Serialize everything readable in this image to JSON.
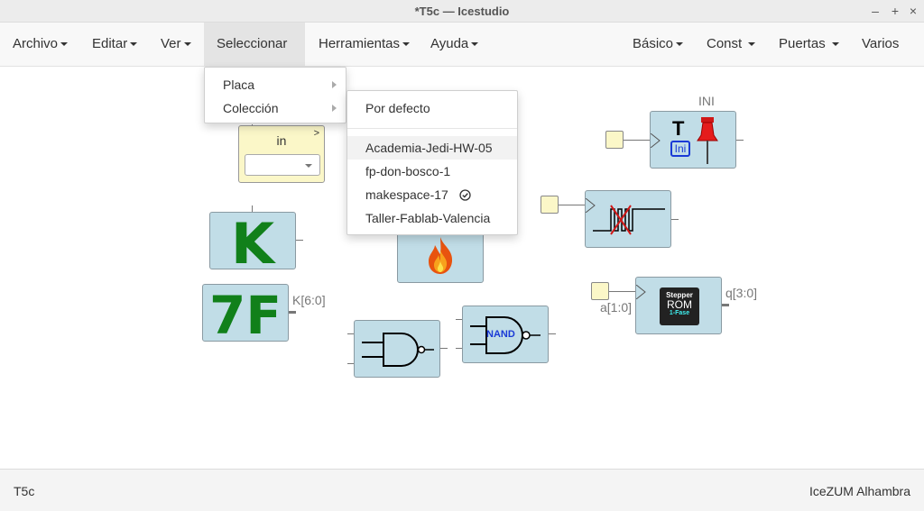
{
  "window": {
    "title": "*T5c — Icestudio"
  },
  "menubar": {
    "left": [
      "Archivo",
      "Editar",
      "Ver",
      "Seleccionar",
      "Herramientas",
      "Ayuda"
    ],
    "right": [
      "Básico",
      "Const",
      "Puertas",
      "Varios"
    ]
  },
  "select_menu": {
    "items": [
      "Placa",
      "Colección"
    ]
  },
  "collection_menu": {
    "default": "Por defecto",
    "items": [
      "Academia-Jedi-HW-05",
      "fp-don-bosco-1",
      "makespace-17",
      "Taller-Fablab-Valencia"
    ],
    "selected": "makespace-17"
  },
  "canvas": {
    "input_block_label": "in",
    "input_block_arrow": ">",
    "k_block": "K",
    "hex_block": "7F",
    "hex_output_label": "K[6:0]",
    "ini_label": "INI",
    "ini_tag": "Ini",
    "t_letter": "T",
    "nand_label": "NAND",
    "rom_chip": {
      "line1": "Stepper",
      "line2": "ROM",
      "line3": "1-Fase"
    },
    "rom_in_label": "a[1:0]",
    "rom_out_label": "q[3:0]"
  },
  "status": {
    "left": "T5c",
    "right": "IceZUM Alhambra"
  }
}
